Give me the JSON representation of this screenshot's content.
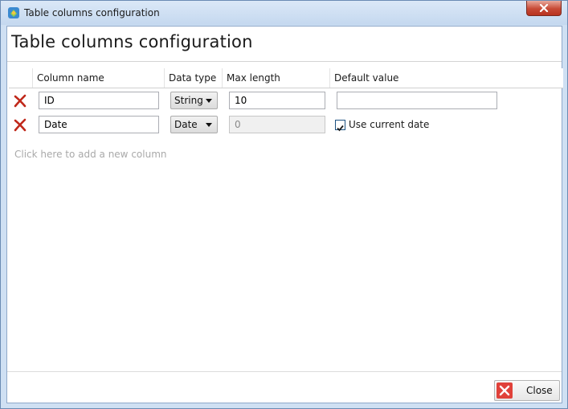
{
  "window": {
    "title": "Table columns configuration",
    "app_icon": "app-icon",
    "close_icon": "close-icon"
  },
  "page": {
    "heading": "Table columns configuration"
  },
  "grid": {
    "headers": [
      "Column name",
      "Data type",
      "Max length",
      "Default value"
    ],
    "rows": [
      {
        "delete_icon": "delete-x-icon",
        "column_name": "ID",
        "data_type": "String",
        "max_length": "10",
        "max_length_enabled": true,
        "default_value": "",
        "default_is_checkbox": false
      },
      {
        "delete_icon": "delete-x-icon",
        "column_name": "Date",
        "data_type": "Date",
        "max_length": "0",
        "max_length_enabled": false,
        "default_is_checkbox": true,
        "default_checked": true,
        "default_label": "Use current date"
      }
    ],
    "add_hint": "Click here to add a new column"
  },
  "footer": {
    "close_label": "Close",
    "close_icon": "close-red-icon"
  },
  "colors": {
    "delete_red": "#c0281a",
    "close_button_red": "#e0413a",
    "title_bar": "#c4d8ef"
  }
}
